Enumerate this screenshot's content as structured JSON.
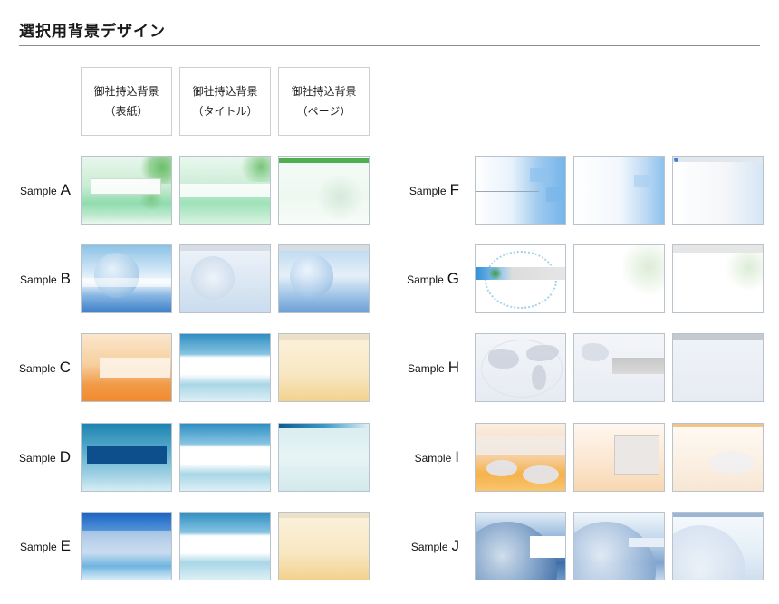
{
  "page": {
    "title": "選択用背景デザイン"
  },
  "headers": [
    {
      "line1": "御社持込背景",
      "line2": "（表紙）"
    },
    {
      "line1": "御社持込背景",
      "line2": "（タイトル）"
    },
    {
      "line1": "御社持込背景",
      "line2": "（ページ）"
    }
  ],
  "samples": [
    {
      "prefix": "Sample",
      "letter": "A",
      "theme": "green-leaf",
      "accent": "#4fae4f"
    },
    {
      "prefix": "Sample",
      "letter": "B",
      "theme": "blue-sky-sphere",
      "accent": "#3f7fc8"
    },
    {
      "prefix": "Sample",
      "letter": "C",
      "theme": "orange-warm",
      "accent": "#f28a2e"
    },
    {
      "prefix": "Sample",
      "letter": "D",
      "theme": "teal-water",
      "accent": "#0d4f8c"
    },
    {
      "prefix": "Sample",
      "letter": "E",
      "theme": "blue-bands",
      "accent": "#1a63c4"
    },
    {
      "prefix": "Sample",
      "letter": "F",
      "theme": "light-blue-blocks",
      "accent": "#74b5ea"
    },
    {
      "prefix": "Sample",
      "letter": "G",
      "theme": "white-leaf",
      "accent": "#2f8fd8"
    },
    {
      "prefix": "Sample",
      "letter": "H",
      "theme": "gray-world-map",
      "accent": "#c9ceda"
    },
    {
      "prefix": "Sample",
      "letter": "I",
      "theme": "orange-world",
      "accent": "#f6b24b"
    },
    {
      "prefix": "Sample",
      "letter": "J",
      "theme": "blue-earth",
      "accent": "#3d6fa8"
    }
  ]
}
